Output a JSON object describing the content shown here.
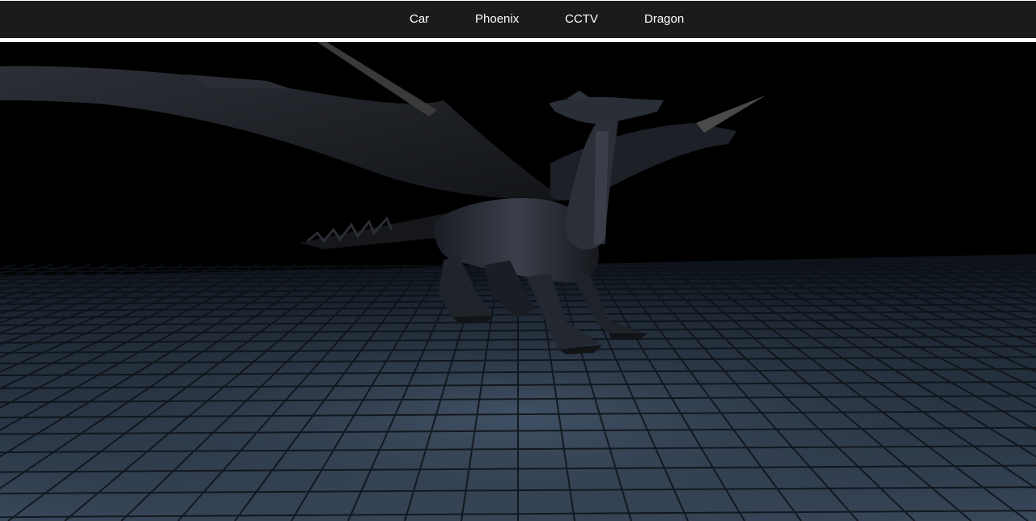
{
  "nav": {
    "items": [
      {
        "label": "Car"
      },
      {
        "label": "Phoenix"
      },
      {
        "label": "CCTV"
      },
      {
        "label": "Dragon"
      }
    ]
  },
  "scene": {
    "subject": "dragon",
    "floor": "stone-tile-grid",
    "background_color": "#000000",
    "floor_color": "#3b4a5c",
    "nav_bg_color": "#1b1b1b"
  }
}
